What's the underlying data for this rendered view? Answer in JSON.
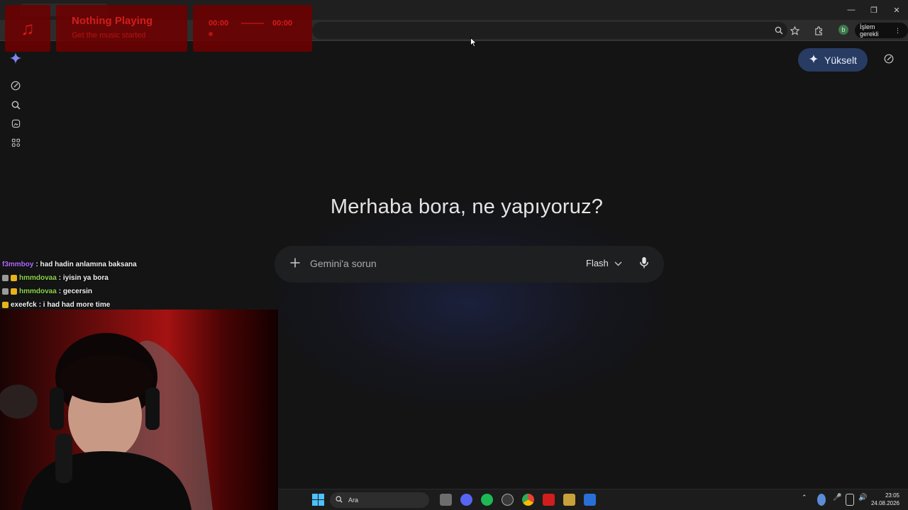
{
  "browser": {
    "profile_initial": "b",
    "action_required_label": "İşlem gerekli"
  },
  "gemini": {
    "upgrade_label": "Yükselt",
    "greeting": "Merhaba bora, ne yapıyoruz?",
    "prompt_placeholder": "Gemini'a sorun",
    "model_label": "Flash"
  },
  "now_playing": {
    "title": "Nothing Playing",
    "subtitle": "Get the music started",
    "elapsed": "00:00",
    "duration": "00:00"
  },
  "chat": [
    {
      "user": "f3mmboy",
      "message": ": had hadin anlamına baksana",
      "user_color": "#b26bff",
      "badges": []
    },
    {
      "user": "hmmdovaa",
      "message": ": iyisin ya bora",
      "user_color": "#8fd44a",
      "badges": [
        "grey",
        "gold"
      ]
    },
    {
      "user": "hmmdovaa",
      "message": ": gecersin",
      "user_color": "#8fd44a",
      "badges": [
        "grey",
        "gold"
      ]
    },
    {
      "user": "exeefck",
      "message": ": i had had more time",
      "user_color": "#f2f2f2",
      "badges": [
        "gold"
      ]
    }
  ],
  "taskbar": {
    "search_label": "Ara",
    "time": "23:05",
    "date": "24.08.2026"
  },
  "colors": {
    "accent": "#283b63",
    "background": "#141415",
    "overlay_red": "#d11d1d"
  }
}
